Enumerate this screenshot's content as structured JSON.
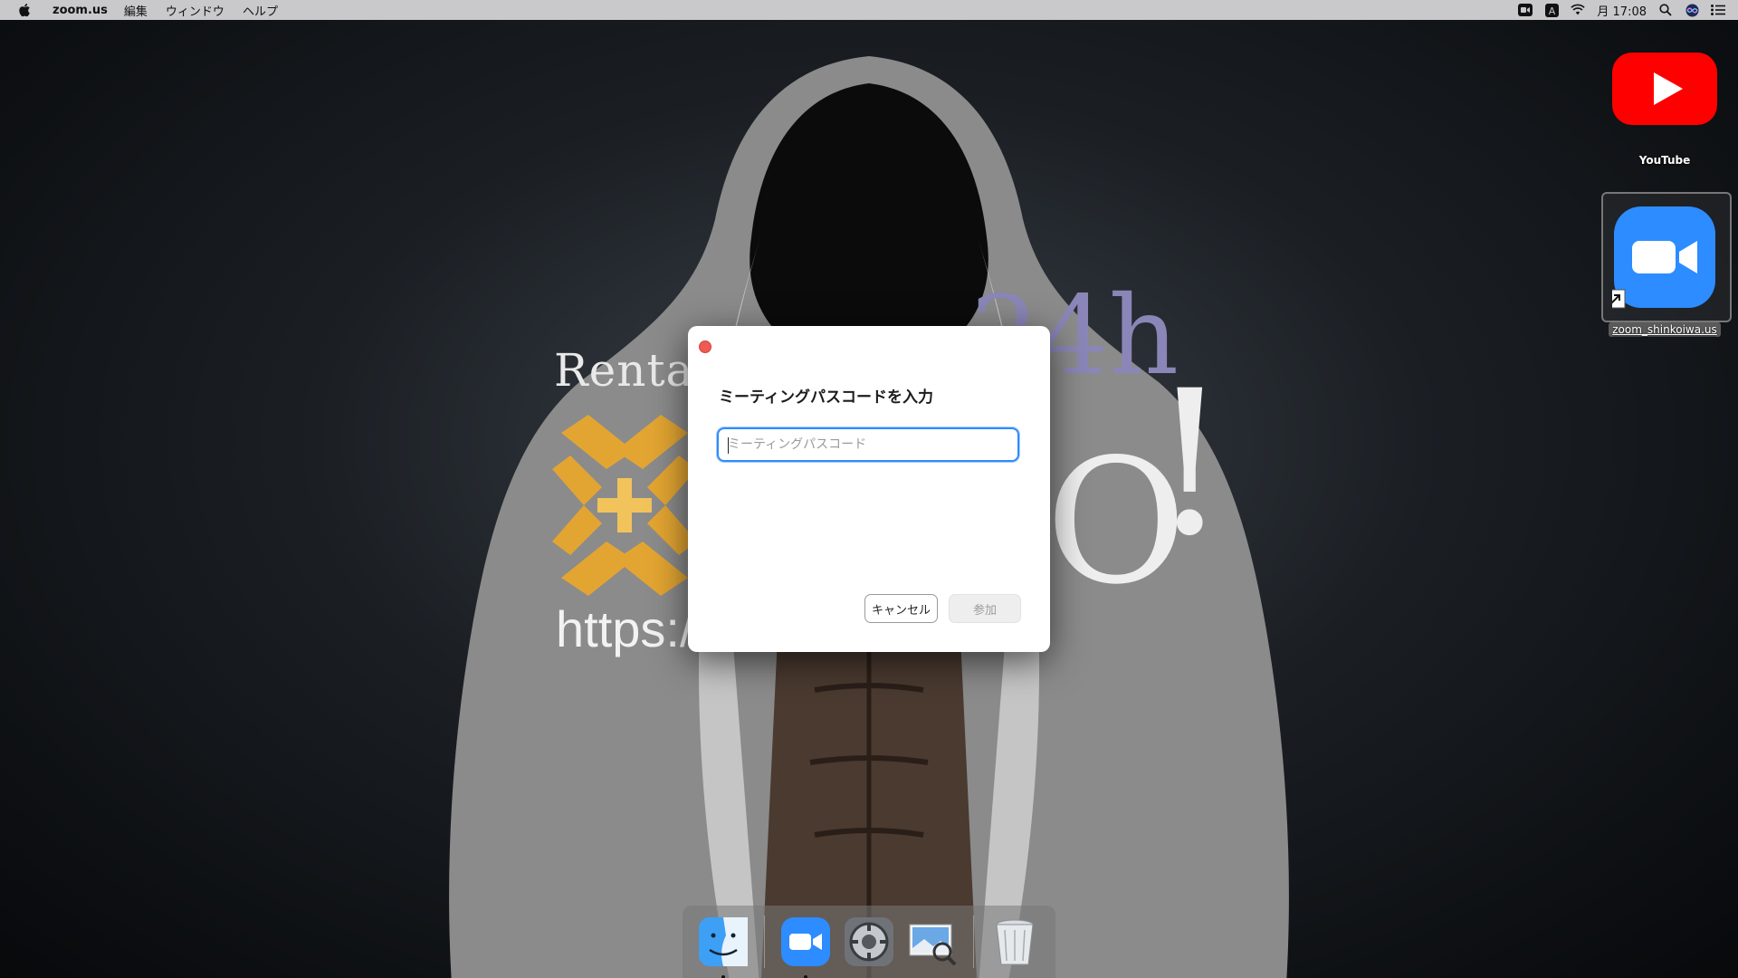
{
  "menubar": {
    "app_name": "zoom.us",
    "menus": [
      "編集",
      "ウィンドウ",
      "ヘルプ"
    ],
    "status_icons": [
      "zoom-status-icon",
      "input-source-icon",
      "wifi-icon"
    ],
    "clock": "月 17:08",
    "right_icons": [
      "spotlight-search-icon",
      "siri-icon",
      "notification-center-icon"
    ]
  },
  "wallpaper": {
    "text_rental": "Rental",
    "text_url": "https:/",
    "text_24h": "24h",
    "text_o": "O",
    "text_excl": "!"
  },
  "desktop_icons": [
    {
      "label": "YouTube",
      "icon": "youtube-icon"
    },
    {
      "label": "zoom_shinkoiwa.us",
      "icon": "zoom-icon"
    }
  ],
  "dialog": {
    "title": "ミーティングパスコードを入力",
    "input_placeholder": "ミーティングパスコード",
    "input_value": "",
    "cancel_label": "キャンセル",
    "join_label": "参加"
  },
  "dock": {
    "items": [
      "finder-icon",
      "zoom-icon",
      "system-preferences-icon",
      "preview-icon",
      "trash-icon"
    ]
  },
  "colors": {
    "accent": "#2d8cff",
    "close": "#ee5b52",
    "youtube": "#ff0000",
    "zoom": "#2d8cff"
  }
}
